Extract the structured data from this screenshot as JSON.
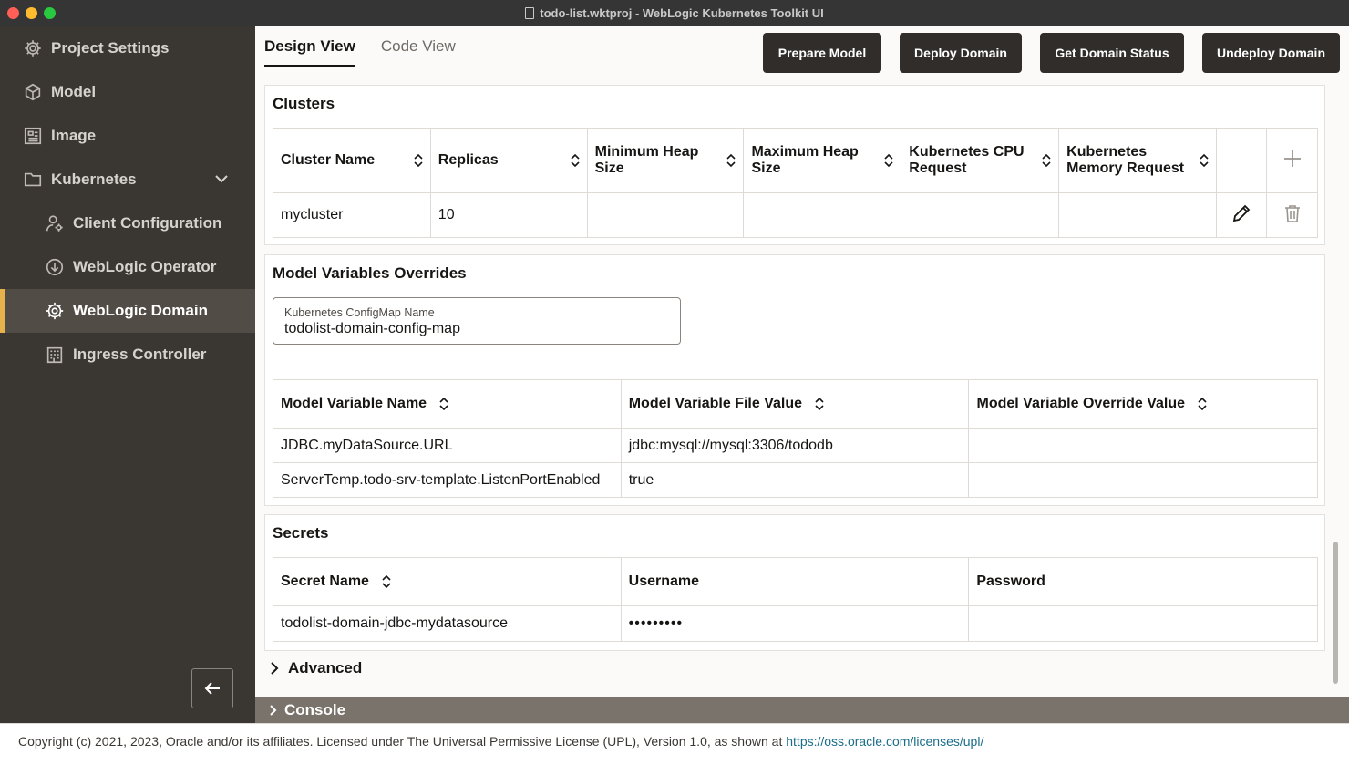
{
  "window": {
    "title": "todo-list.wktproj - WebLogic Kubernetes Toolkit UI"
  },
  "sidebar": {
    "items": [
      {
        "label": "Project Settings",
        "icon": "gear-icon"
      },
      {
        "label": "Model",
        "icon": "cube-icon"
      },
      {
        "label": "Image",
        "icon": "image-icon"
      },
      {
        "label": "Kubernetes",
        "icon": "folder-icon"
      },
      {
        "label": "Client Configuration",
        "icon": "user-gear-icon"
      },
      {
        "label": "WebLogic Operator",
        "icon": "download-circle-icon"
      },
      {
        "label": "WebLogic Domain",
        "icon": "domain-gear-icon"
      },
      {
        "label": "Ingress Controller",
        "icon": "building-icon"
      }
    ],
    "active": "WebLogic Domain",
    "accent_color": "#e7b24b"
  },
  "tabs": [
    {
      "label": "Design View"
    },
    {
      "label": "Code View"
    }
  ],
  "toolbar": {
    "prepare": "Prepare Model",
    "deploy": "Deploy Domain",
    "status": "Get Domain Status",
    "undeploy": "Undeploy Domain"
  },
  "clusters": {
    "title": "Clusters",
    "headers": {
      "name": "Cluster Name",
      "replicas": "Replicas",
      "min_heap": "Minimum Heap Size",
      "max_heap": "Maximum Heap Size",
      "cpu": "Kubernetes CPU Request",
      "memory": "Kubernetes Memory Request"
    },
    "rows": [
      {
        "name": "mycluster",
        "replicas": "10",
        "min_heap": "",
        "max_heap": "",
        "cpu": "",
        "memory": ""
      }
    ]
  },
  "overrides": {
    "title": "Model Variables Overrides",
    "configmap": {
      "label": "Kubernetes ConfigMap Name",
      "value": "todolist-domain-config-map"
    },
    "headers": {
      "name": "Model Variable Name",
      "file_value": "Model Variable File Value",
      "override_value": "Model Variable Override Value"
    },
    "rows": [
      {
        "name": "JDBC.myDataSource.URL",
        "file_value": "jdbc:mysql://mysql:3306/tododb",
        "override_value": ""
      },
      {
        "name": "ServerTemp.todo-srv-template.ListenPortEnabled",
        "file_value": "true",
        "override_value": ""
      }
    ]
  },
  "secrets": {
    "title": "Secrets",
    "headers": {
      "name": "Secret Name",
      "username": "Username",
      "password": "Password"
    },
    "rows": [
      {
        "name": "todolist-domain-jdbc-mydatasource",
        "username": "•••••••••",
        "password": ""
      }
    ]
  },
  "advanced": {
    "label": "Advanced"
  },
  "console": {
    "label": "Console"
  },
  "footer": {
    "text": "Copyright (c) 2021, 2023, Oracle and/or its affiliates. Licensed under The Universal Permissive License (UPL), Version 1.0, as shown at ",
    "link": "https://oss.oracle.com/licenses/upl/"
  }
}
